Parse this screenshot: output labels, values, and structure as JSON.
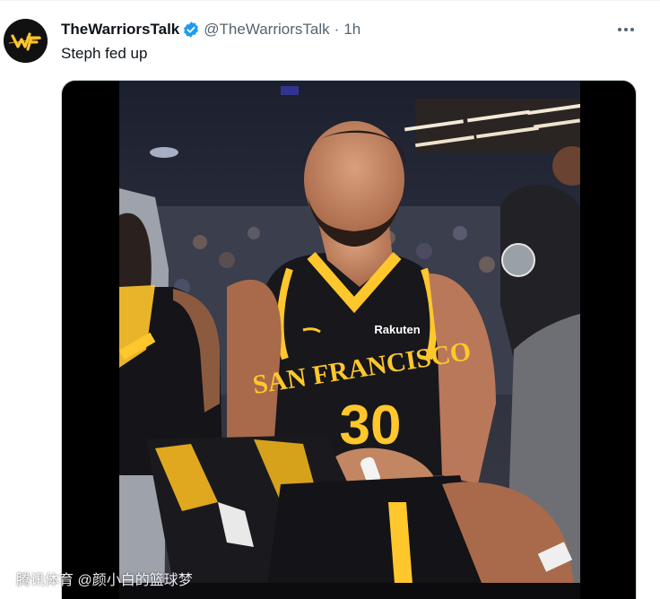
{
  "tweet": {
    "author": {
      "display_name": "TheWarriorsTalk",
      "handle": "@TheWarriorsTalk",
      "verified": true,
      "avatar_icon": "warriors-logo-icon"
    },
    "separator": "·",
    "time": "1h",
    "text": "Steph fed up",
    "more_icon": "more-horizontal-icon",
    "media": {
      "type": "video",
      "jersey_text": "SAN FRANCISCO",
      "jersey_number": "30",
      "jersey_sponsor": "Rakuten"
    }
  },
  "watermark": "腾讯体育 @颜小白的篮球梦",
  "colors": {
    "text_primary": "#0f1419",
    "text_secondary": "#536471",
    "verified_blue": "#1d9bf0",
    "warriors_gold": "#ffc72c",
    "media_border": "#cfd9de"
  }
}
